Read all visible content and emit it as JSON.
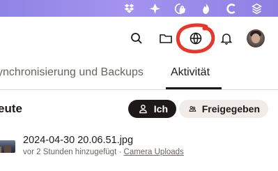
{
  "menubar": {
    "icons": [
      "dropbox-icon",
      "bolt-pinwheel-icon",
      "lock-shield-icon",
      "flame-icon",
      "c-letter-icon",
      "layers-icon"
    ]
  },
  "header": {
    "icons": [
      "search-icon",
      "folder-icon",
      "globe-icon",
      "bell-icon"
    ],
    "annotation_color": "#e8362d",
    "avatar": "user-avatar"
  },
  "tabs": [
    {
      "label": "ynchronisierung und Backups",
      "active": false
    },
    {
      "label": "Aktivität",
      "active": true
    }
  ],
  "section": {
    "title": "eute"
  },
  "filters": {
    "me_label": "Ich",
    "shared_label": "Freigegeben"
  },
  "activity": {
    "items": [
      {
        "file_name": "2024-04-30 20.06.51.jpg",
        "added_text": "vor 2 Stunden hinzugefügt",
        "separator": " · ",
        "location": "Camera Uploads"
      }
    ]
  },
  "colors": {
    "menubar": "#9a8cea",
    "text": "#1e1919",
    "muted": "#6a6360",
    "pill_dark": "#1e1919",
    "pill_light": "#f1ece8"
  }
}
